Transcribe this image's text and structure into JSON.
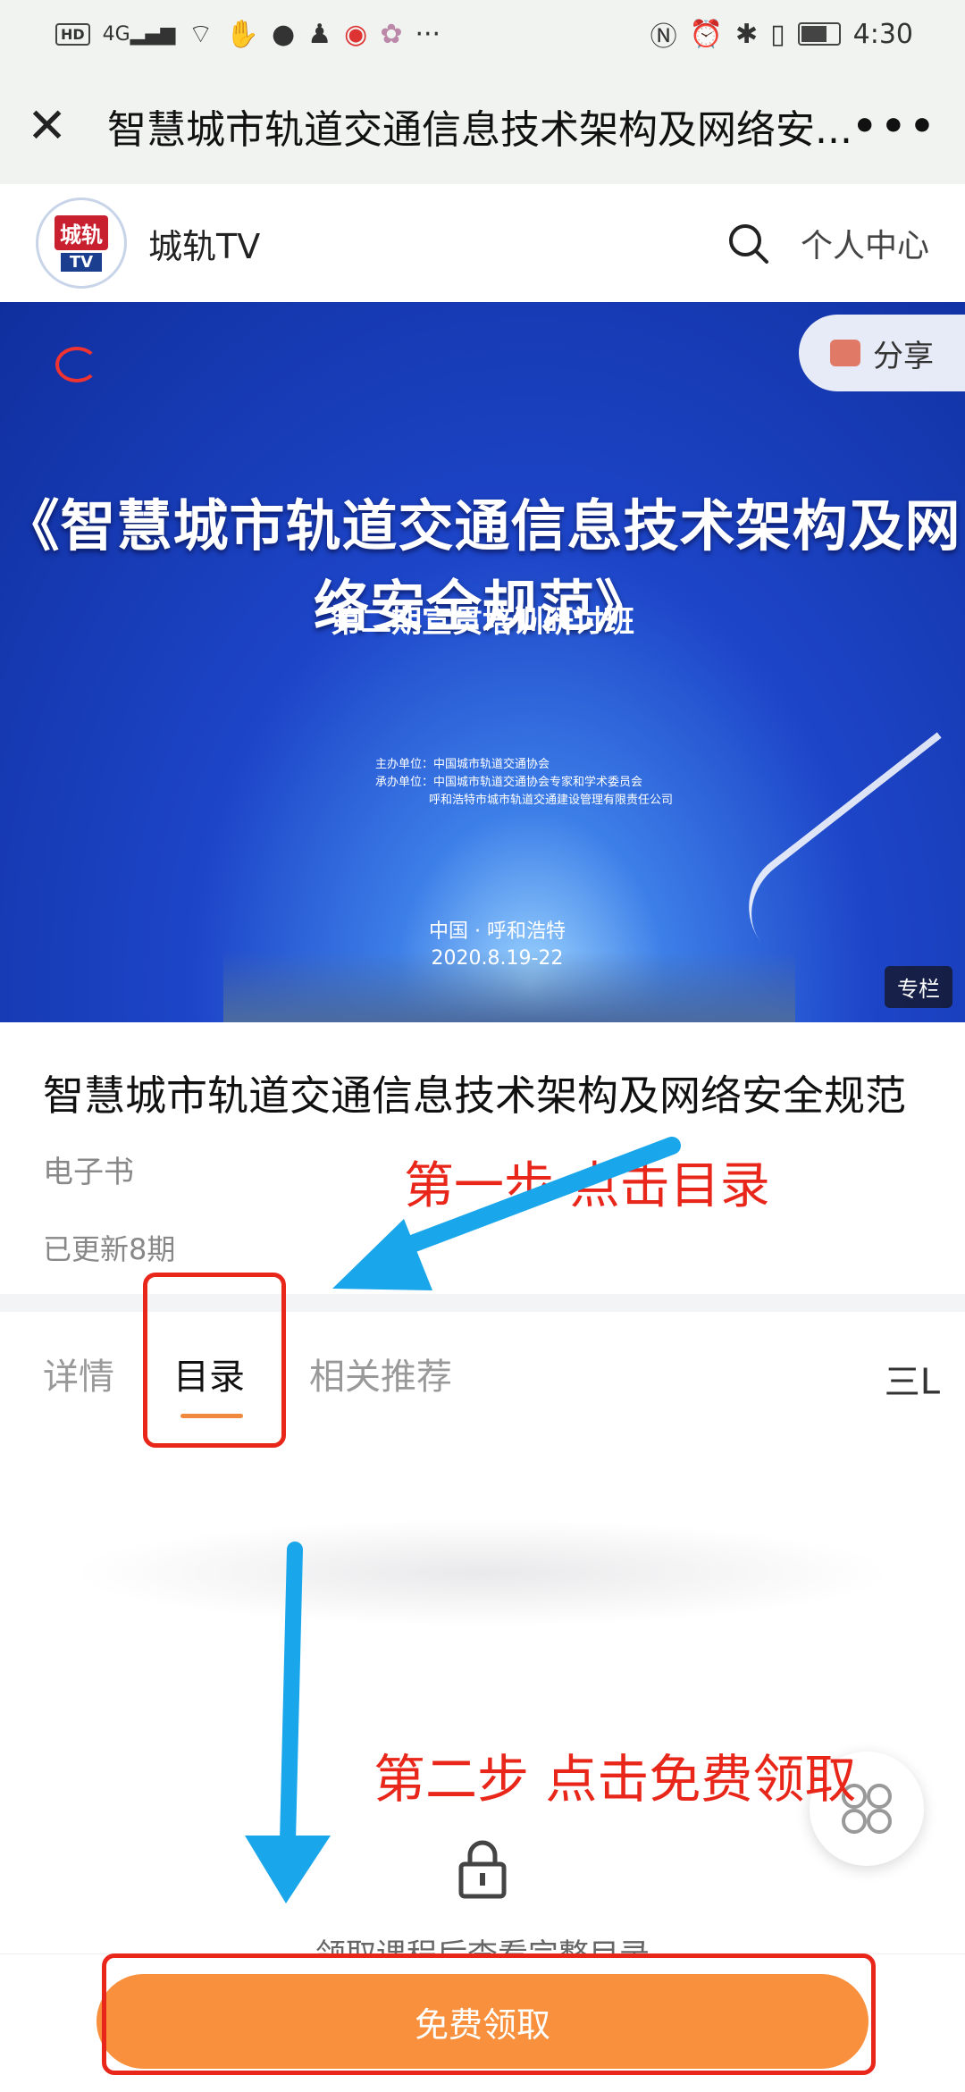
{
  "status_bar": {
    "time": "4:30",
    "hd": "HD",
    "network": "4G",
    "more": "···"
  },
  "nav": {
    "title": "智慧城市轨道交通信息技术架构及网络安...",
    "close_icon": "close-icon",
    "more_icon": "more-icon"
  },
  "header": {
    "logo_top": "城轨",
    "logo_bottom": "TV",
    "app_name": "城轨TV",
    "personal": "个人中心"
  },
  "banner": {
    "share": "分享",
    "main_title": "《智慧城市轨道交通信息技术架构及网络安全规范》",
    "subtitle": "第二期宣贯培训研讨班",
    "host": "主办单位：中国城市轨道交通协会",
    "co_host": "承办单位：中国城市轨道交通协会专家和学术委员会",
    "co_host2": "呼和浩特市城市轨道交通建设管理有限责任公司",
    "place": "中国 · 呼和浩特",
    "date": "2020.8.19-22",
    "tag": "专栏"
  },
  "info": {
    "title": "智慧城市轨道交通信息技术架构及网络安全规范",
    "type": "电子书",
    "updated": "已更新8期"
  },
  "tabs": [
    {
      "label": "详情"
    },
    {
      "label": "目录"
    },
    {
      "label": "相关推荐"
    }
  ],
  "menu_icon": "三ᒪ",
  "lock_text": "领取课程后查看完整目录",
  "cta": {
    "label": "免费领取"
  },
  "annotations": {
    "step1": "第一步 点击目录",
    "step2": "第二步 点击免费领取"
  },
  "colors": {
    "accent": "#f8903e",
    "annotation": "#e8261a",
    "arrow": "#19a6ea"
  }
}
